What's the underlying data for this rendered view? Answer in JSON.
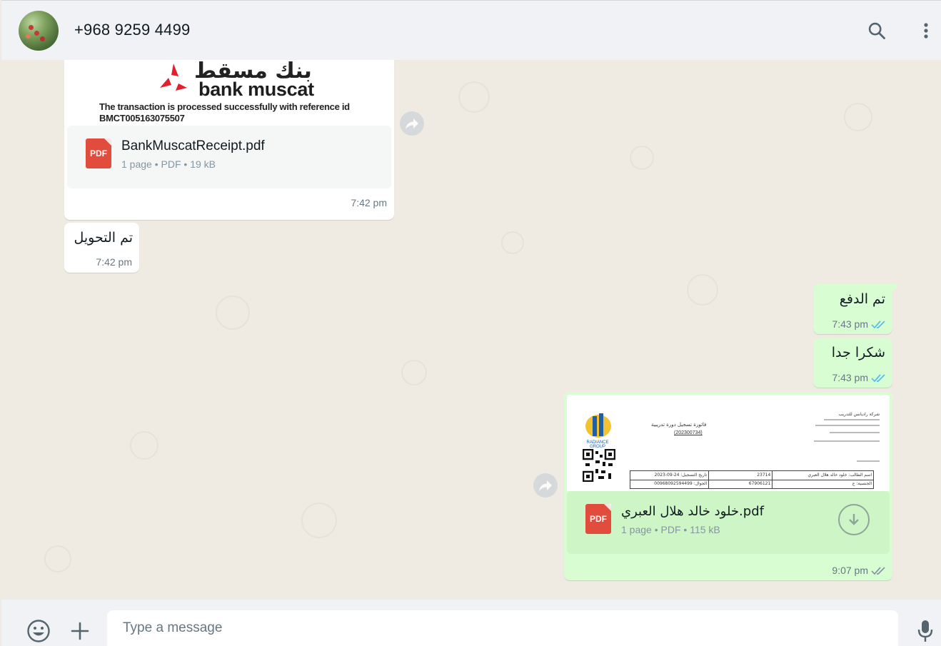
{
  "header": {
    "contact_name": "+968 9259 4499"
  },
  "messages": {
    "receipt": {
      "logo_arabic": "بنك مسقط",
      "logo_english": "bank muscat",
      "preview_line1": "The transaction is processed successfully with reference id",
      "preview_line2": "BMCT005163075507",
      "file_name": "BankMuscatReceipt.pdf",
      "pages": "1 page",
      "file_type": "PDF",
      "file_size": "19 kB",
      "time": "7:42 pm"
    },
    "transferred": {
      "text": "تم التحويل",
      "time": "7:42 pm"
    },
    "paid": {
      "text": "تم الدفع",
      "time": "7:43 pm"
    },
    "thanks": {
      "text": "شكرا جدا",
      "time": "7:43 pm"
    },
    "invoice": {
      "file_name": "خلود خالد هلال العبري.pdf",
      "pages": "1 page",
      "file_type": "PDF",
      "file_size": "115 kB",
      "time": "9:07 pm",
      "preview_logo": "RADIANCE GROUP",
      "preview_title": "فاتورة تسجيل دورة تدريبية",
      "preview_ref": "(202300734)",
      "preview_company": "شركة راديانس للتدريب",
      "preview_table_row1": [
        "تاريخ التسجيل: 24-09-2023",
        "23714",
        "اسم الطالب: خلود خالد هلال العبري"
      ],
      "preview_table_row2": [
        "الجوال: 00968092594499",
        "67906121",
        "الجنسية: ع"
      ]
    }
  },
  "composer": {
    "placeholder": "Type a message"
  },
  "icons": {
    "pdf_label": "PDF"
  },
  "colors": {
    "outgoing_bubble": "#d9fdd3",
    "incoming_bubble": "#ffffff",
    "read_ticks": "#53bdeb",
    "pdf_red": "#e24c3c",
    "bank_red": "#e31e2d"
  }
}
